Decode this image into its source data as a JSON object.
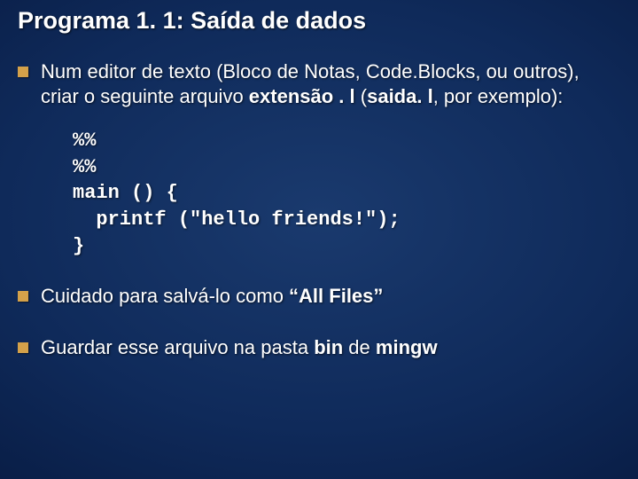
{
  "title": "Programa 1. 1:  Saída de dados",
  "bullets": {
    "b1_pre": "Num editor de texto (Bloco de Notas, Code.Blocks, ou outros), criar o seguinte arquivo ",
    "b1_bold1": "extensão . l",
    "b1_mid": " (",
    "b1_bold2": "saida. l",
    "b1_post": ", por exemplo):",
    "b2_pre": "Cuidado para salvá-lo como ",
    "b2_bold": "“All Files”",
    "b3_pre": "Guardar esse arquivo na pasta ",
    "b3_bold1": "bin",
    "b3_mid": " de ",
    "b3_bold2": "mingw"
  },
  "code": "%%\n%%\nmain () {\n  printf (\"hello friends!\");\n}"
}
